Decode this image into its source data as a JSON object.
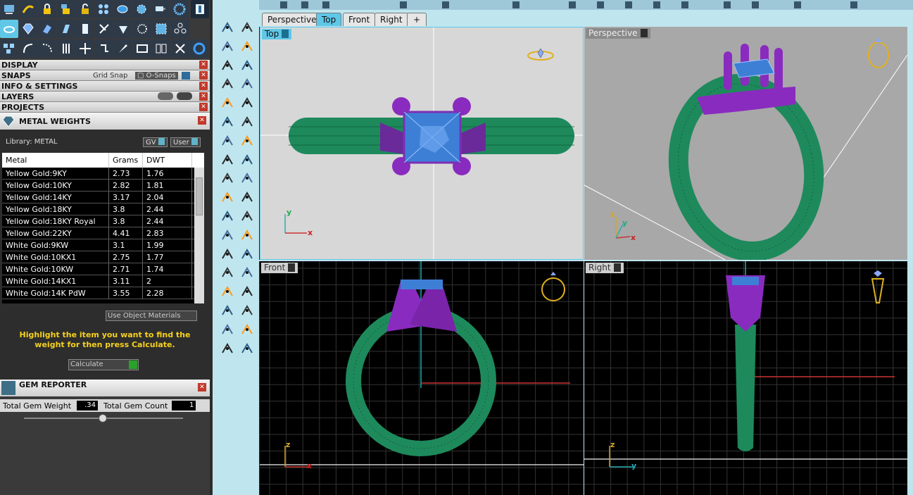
{
  "display_section": {
    "title": "DISPLAY"
  },
  "snaps_section": {
    "title": "SNAPS",
    "grid_snap": "Grid Snap",
    "o_snaps": "O-Snaps"
  },
  "info_section": {
    "title": "INFO & SETTINGS"
  },
  "layers_section": {
    "title": "LAYERS"
  },
  "projects_section": {
    "title": "PROJECTS"
  },
  "metal_weights": {
    "title": "METAL WEIGHTS",
    "library": "Library: METAL",
    "gv_label": "GV",
    "user_label": "User",
    "columns": [
      "Metal",
      "Grams",
      "DWT"
    ],
    "rows": [
      [
        "Yellow Gold:9KY",
        "2.73",
        "1.76"
      ],
      [
        "Yellow Gold:10KY",
        "2.82",
        "1.81"
      ],
      [
        "Yellow Gold:14KY",
        "3.17",
        "2.04"
      ],
      [
        "Yellow Gold:18KY",
        "3.8",
        "2.44"
      ],
      [
        "Yellow Gold:18KY Royal",
        "3.8",
        "2.44"
      ],
      [
        "Yellow Gold:22KY",
        "4.41",
        "2.83"
      ],
      [
        "White Gold:9KW",
        "3.1",
        "1.99"
      ],
      [
        "White Gold:10KX1",
        "2.75",
        "1.77"
      ],
      [
        "White Gold:10KW",
        "2.71",
        "1.74"
      ],
      [
        "White Gold:14KX1",
        "3.11",
        "2"
      ],
      [
        "White Gold:14K PdW",
        "3.55",
        "2.28"
      ]
    ],
    "use_object_materials": "Use Object Materials",
    "hint": "Highlight the item you want to find the weight for then press Calculate.",
    "calculate_label": "Calculate"
  },
  "gem_reporter": {
    "title": "GEM REPORTER",
    "total_gem_weight_label": "Total Gem Weight",
    "total_gem_weight": ".34",
    "total_gem_count_label": "Total Gem Count",
    "total_gem_count": "1"
  },
  "tabs": [
    "Perspective",
    "Top",
    "Front",
    "Right",
    "+"
  ],
  "active_tab": "Top",
  "viewports": {
    "top": {
      "label": "Top"
    },
    "perspective": {
      "label": "Perspective"
    },
    "front": {
      "label": "Front"
    },
    "right": {
      "label": "Right"
    }
  },
  "axes": {
    "x": "x",
    "y": "y",
    "z": "z"
  },
  "colors": {
    "band": "#1e8a5c",
    "prongs": "#8a2bbf",
    "gem": "#3e7fd6",
    "accent": "#5fc7e8",
    "panel_bg": "#3a3a3a",
    "toolbar_bg": "#bfe6ef"
  },
  "icons": {
    "metal_weights": "diamond-icon",
    "gem_reporter": "gem-report-icon",
    "layers": "eye-icon",
    "ring_indicator": "ring-icon"
  }
}
